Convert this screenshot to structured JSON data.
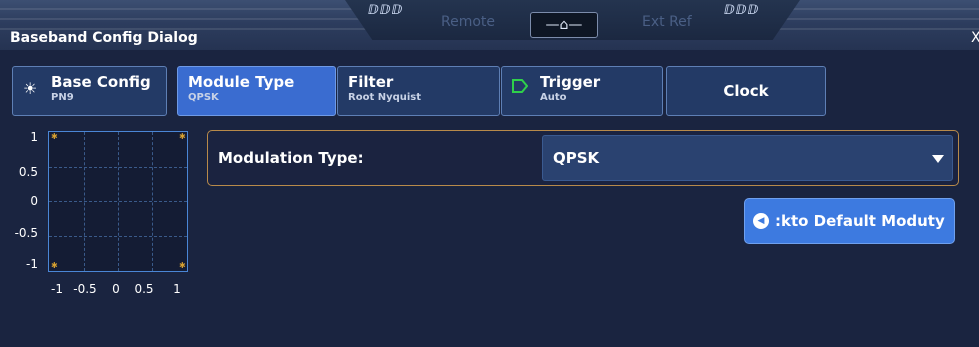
{
  "header": {
    "deco_left": "ⅅⅅⅅ",
    "deco_right": "ⅅⅅⅅ",
    "status_remote": "Remote",
    "status_ext_ref": "Ext Ref",
    "home_glyph": "—⌂—",
    "dialog_title": "Baseband Config Dialog",
    "close_glyph": "X"
  },
  "tabs": [
    {
      "label": "Base Config",
      "sub": "PN9",
      "icon": "sun-icon"
    },
    {
      "label": "Module Type",
      "sub": "QPSK",
      "active": true
    },
    {
      "label": "Filter",
      "sub": "Root Nyquist"
    },
    {
      "label": "Trigger",
      "sub": "Auto",
      "icon": "trigger-arrow-icon"
    },
    {
      "label": "Clock",
      "sub": ""
    }
  ],
  "constellation": {
    "y_ticks": [
      "1",
      "0.5",
      "0",
      "-0.5",
      "-1"
    ],
    "x_ticks": [
      "-1",
      "-0.5",
      "0",
      "0.5",
      "1"
    ],
    "points": [
      [
        -1,
        1
      ],
      [
        1,
        1
      ],
      [
        -1,
        -1
      ],
      [
        1,
        -1
      ]
    ],
    "point_color": "#d6a030"
  },
  "modulation": {
    "label": "Modulation Type:",
    "value": "QPSK"
  },
  "default_button": {
    "label": ":kto Default Moduty",
    "icon": "reset-icon"
  },
  "colors": {
    "background": "#1a2440",
    "tab_active": "#3a6cd0",
    "tab": "#233a66",
    "button": "#3d7ae0",
    "accent_border": "#b88a4a"
  }
}
